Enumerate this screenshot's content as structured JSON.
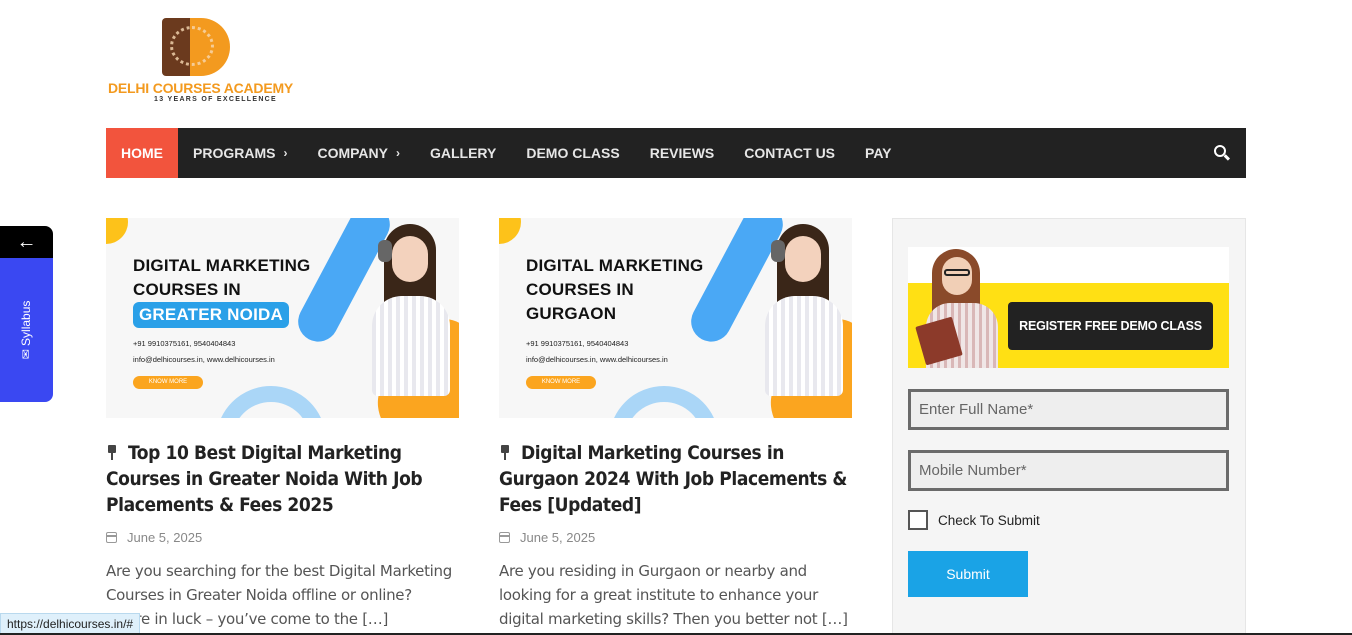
{
  "logo": {
    "title": "DELHI COURSES ACADEMY",
    "tagline": "13 YEARS OF EXCELLENCE",
    "colors": {
      "brown": "#6b3a1e",
      "orange": "#f39a1f"
    }
  },
  "nav": {
    "items": [
      {
        "label": "HOME",
        "active": true
      },
      {
        "label": "PROGRAMS",
        "has_submenu": true
      },
      {
        "label": "COMPANY",
        "has_submenu": true
      },
      {
        "label": "GALLERY"
      },
      {
        "label": "DEMO CLASS"
      },
      {
        "label": "REVIEWS"
      },
      {
        "label": "CONTACT US"
      },
      {
        "label": "PAY"
      }
    ],
    "submenu_icon": "chevron-right-icon",
    "search_icon": "search-icon",
    "colors": {
      "bar": "#222222",
      "active": "#f2543d"
    }
  },
  "side_tab": {
    "arrow": "←",
    "label": "Syllabus",
    "icon": "envelope-icon",
    "color": "#3a48f2"
  },
  "posts": [
    {
      "banner": {
        "line1": "DIGITAL MARKETING",
        "line2": "COURSES IN",
        "city": "GREATER NOIDA",
        "phone": "+91 9910375161, 9540404843",
        "web": "info@delhicourses.in, www.delhicourses.in",
        "button": "KNOW MORE"
      },
      "title": "Top 10 Best Digital Marketing Courses in Greater Noida With Job Placements & Fees 2025",
      "date": "June 5, 2025",
      "excerpt": "Are you searching for the best Digital Marketing Courses in Greater Noida offline or online? You’re in luck – you’ve come to the […]"
    },
    {
      "banner": {
        "line1": "DIGITAL MARKETING",
        "line2": "COURSES IN",
        "city": "GURGAON",
        "phone": "+91 9910375161, 9540404843",
        "web": "info@delhicourses.in, www.delhicourses.in",
        "button": "KNOW MORE"
      },
      "title": "Digital Marketing Courses in Gurgaon 2024 With Job Placements & Fees [Updated]",
      "date": "June 5, 2025",
      "excerpt": "Are you residing in Gurgaon or nearby and looking for a great institute to enhance your digital marketing skills? Then you better not […]"
    }
  ],
  "sidebar": {
    "demo_banner_label": "REGISTER FREE DEMO CLASS",
    "name_placeholder": "Enter Full Name*",
    "mobile_placeholder": "Mobile Number*",
    "checkbox_label": "Check To Submit",
    "submit_label": "Submit",
    "colors": {
      "banner": "#ffe014",
      "submit": "#1aa3e6"
    }
  },
  "status_bar": {
    "url": "https://delhicourses.in/#"
  }
}
